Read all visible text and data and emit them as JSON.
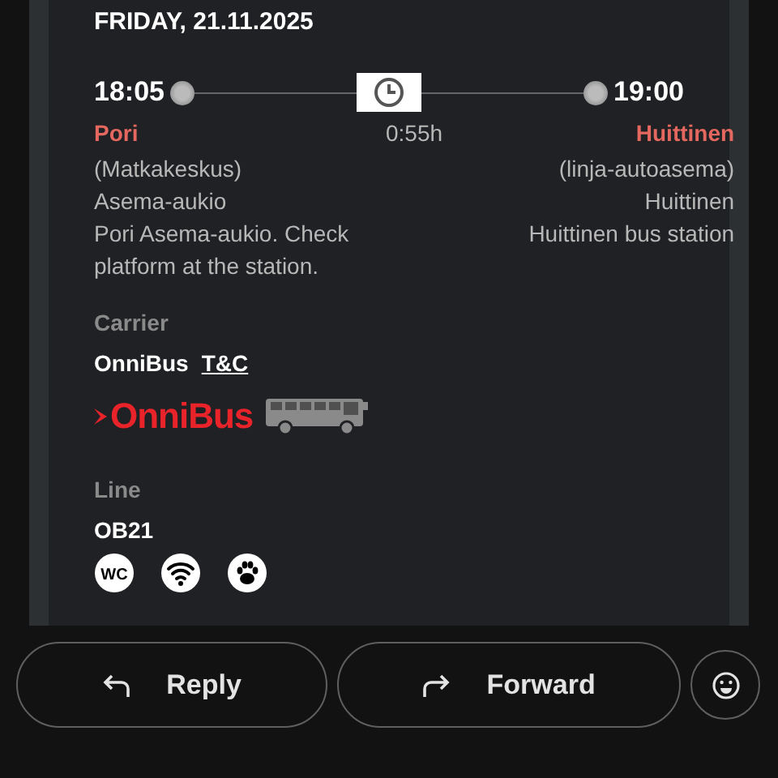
{
  "date": "FRIDAY, 21.11.2025",
  "departure": {
    "time": "18:05",
    "city": "Pori",
    "details": [
      "(Matkakeskus)",
      "Asema-aukio",
      "Pori Asema-aukio. Check platform at the station."
    ]
  },
  "duration": "0:55h",
  "arrival": {
    "time": "19:00",
    "city": "Huittinen",
    "details": [
      "(linja-autoasema)",
      "Huittinen",
      "Huittinen bus station"
    ]
  },
  "carrier": {
    "label": "Carrier",
    "name": "OnniBus",
    "link": "T&C",
    "logo": "OnniBus"
  },
  "line": {
    "label": "Line",
    "code": "OB21",
    "amenities": [
      {
        "kind": "wc",
        "text": "WC"
      },
      {
        "kind": "wifi"
      },
      {
        "kind": "pets"
      }
    ]
  },
  "actions": [
    {
      "kind": "reply",
      "label": "Reply"
    },
    {
      "kind": "forward",
      "label": "Forward"
    }
  ]
}
